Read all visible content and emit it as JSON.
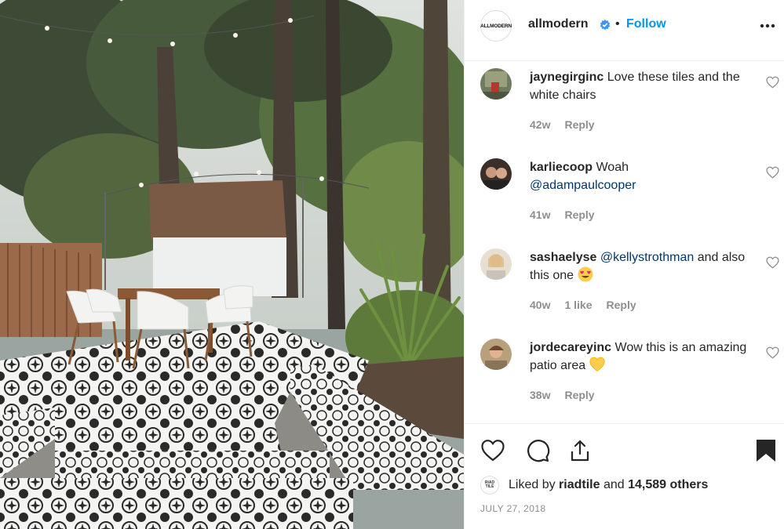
{
  "post": {
    "photo_alt": "",
    "account": {
      "avatar_text": "ALLMODERN",
      "username": "allmodern",
      "verified": true,
      "separator": "•",
      "follow_label": "Follow"
    },
    "more_icon": "more-horizontal-icon",
    "comments": [
      {
        "user": "jaynegirginc",
        "text": "Love these tiles and the white chairs",
        "mention": "",
        "emoji": "",
        "age": "42w",
        "likes": "",
        "reply_label": "Reply"
      },
      {
        "user": "karliecoop",
        "text": "Woah",
        "mention": "@adampaulcooper",
        "emoji": "",
        "age": "41w",
        "likes": "",
        "reply_label": "Reply"
      },
      {
        "user": "sashaelyse",
        "text_before": "",
        "mention": "@kellystrothman",
        "text": "and also this one",
        "emoji": "heart-eyes-emoji",
        "age": "40w",
        "likes": "1 like",
        "reply_label": "Reply"
      },
      {
        "user": "jordecareyinc",
        "text": "Wow this is an amazing patio area",
        "mention": "",
        "emoji": "yellow-heart-emoji",
        "age": "38w",
        "likes": "",
        "reply_label": "Reply"
      }
    ],
    "actions": {
      "like_icon": "heart-icon",
      "comment_icon": "comment-icon",
      "share_icon": "share-icon",
      "save_icon": "bookmark-icon"
    },
    "liked_by": {
      "avatar_text": "RIAD TILE",
      "prefix": "Liked by",
      "user": "riadtile",
      "joiner": "and",
      "count": "14,589 others"
    },
    "date": "JULY 27, 2018"
  },
  "colors": {
    "link_blue": "#0095f6",
    "mention_blue": "#00376b",
    "meta_gray": "#8e8e8e",
    "text": "#262626"
  }
}
